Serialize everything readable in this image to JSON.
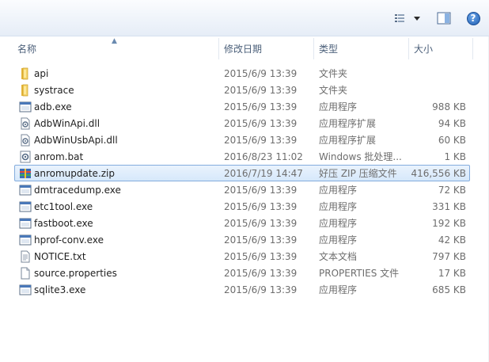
{
  "header": {
    "name": "名称",
    "date": "修改日期",
    "type": "类型",
    "size": "大小"
  },
  "toolbar": {
    "views_icon": "view-list-icon",
    "preview_icon": "preview-pane-icon",
    "help_label": "?"
  },
  "files": [
    {
      "name": "api",
      "date": "2015/6/9 13:39",
      "type": "文件夹",
      "size": "",
      "icon": "folder"
    },
    {
      "name": "systrace",
      "date": "2015/6/9 13:39",
      "type": "文件夹",
      "size": "",
      "icon": "folder"
    },
    {
      "name": "adb.exe",
      "date": "2015/6/9 13:39",
      "type": "应用程序",
      "size": "988 KB",
      "icon": "exe"
    },
    {
      "name": "AdbWinApi.dll",
      "date": "2015/6/9 13:39",
      "type": "应用程序扩展",
      "size": "94 KB",
      "icon": "dll"
    },
    {
      "name": "AdbWinUsbApi.dll",
      "date": "2015/6/9 13:39",
      "type": "应用程序扩展",
      "size": "60 KB",
      "icon": "dll"
    },
    {
      "name": "anrom.bat",
      "date": "2016/8/23 11:02",
      "type": "Windows 批处理...",
      "size": "1 KB",
      "icon": "bat"
    },
    {
      "name": "anromupdate.zip",
      "date": "2016/7/19 14:47",
      "type": "好压 ZIP 压缩文件",
      "size": "416,556 KB",
      "icon": "zip",
      "selected": true
    },
    {
      "name": "dmtracedump.exe",
      "date": "2015/6/9 13:39",
      "type": "应用程序",
      "size": "72 KB",
      "icon": "exe"
    },
    {
      "name": "etc1tool.exe",
      "date": "2015/6/9 13:39",
      "type": "应用程序",
      "size": "331 KB",
      "icon": "exe"
    },
    {
      "name": "fastboot.exe",
      "date": "2015/6/9 13:39",
      "type": "应用程序",
      "size": "192 KB",
      "icon": "exe"
    },
    {
      "name": "hprof-conv.exe",
      "date": "2015/6/9 13:39",
      "type": "应用程序",
      "size": "42 KB",
      "icon": "exe"
    },
    {
      "name": "NOTICE.txt",
      "date": "2015/6/9 13:39",
      "type": "文本文档",
      "size": "797 KB",
      "icon": "txt"
    },
    {
      "name": "source.properties",
      "date": "2015/6/9 13:39",
      "type": "PROPERTIES 文件",
      "size": "17 KB",
      "icon": "file"
    },
    {
      "name": "sqlite3.exe",
      "date": "2015/6/9 13:39",
      "type": "应用程序",
      "size": "685 KB",
      "icon": "exe"
    }
  ]
}
